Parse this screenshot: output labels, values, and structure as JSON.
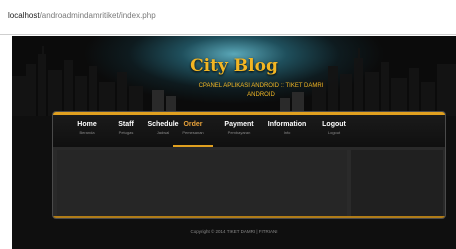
{
  "browser": {
    "url_host": "localhost",
    "url_path": "/androadmindamritiket/index.php"
  },
  "header": {
    "title": "City Blog",
    "subtitle": "CPANEL APLIKASI ANDROID :: TIKET DAMRI ANDROID"
  },
  "nav": {
    "items": [
      {
        "label": "Home",
        "sub": "Beranda"
      },
      {
        "label": "Staff",
        "sub": "Petugas"
      },
      {
        "label": "Schedule",
        "sub": "Jadwal"
      },
      {
        "label": "Order",
        "sub": "Pemesanan"
      },
      {
        "label": "Payment",
        "sub": "Pembayaran"
      },
      {
        "label": "Information",
        "sub": "Info"
      },
      {
        "label": "Logout",
        "sub": "Logout"
      }
    ],
    "active_index": 3
  },
  "footer": {
    "text": "Copyright © 2014 TIKET DAMRI | FITRIANI"
  },
  "colors": {
    "accent": "#e0a020",
    "title": "#f2b624",
    "active_nav": "#e8a23a"
  }
}
